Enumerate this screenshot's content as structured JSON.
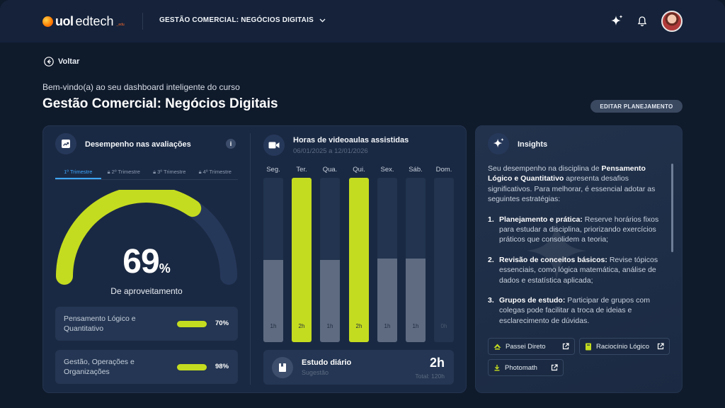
{
  "header": {
    "logo_brand": "uol",
    "logo_product": "edtech",
    "logo_suffix": "_edu",
    "course_selector": "GESTÃO COMERCIAL: NEGÓCIOS DIGITAIS"
  },
  "page": {
    "back_label": "Voltar",
    "welcome": "Bem-vindo(a) ao seu dashboard inteligente do curso",
    "title": "Gestão Comercial: Negócios Digitais",
    "edit_button": "EDITAR PLANEJAMENTO"
  },
  "performance": {
    "title": "Desempenho nas avaliações",
    "info": "i",
    "tabs": [
      "1º Trimestre",
      "2º Trimestre",
      "3º Trimestre",
      "4º Trimestre"
    ],
    "score_value": "69",
    "score_unit": "%",
    "score_fraction": 0.69,
    "score_label": "De aproveitamento",
    "subjects": [
      {
        "name": "Pensamento Lógico e Quantitativo",
        "value": "70%"
      },
      {
        "name": "Gestão, Operações e Organizações",
        "value": "98%"
      }
    ]
  },
  "videos": {
    "title": "Horas de videoaulas assistidas",
    "date_range": "06/01/2025 a 12/01/2026",
    "days": [
      {
        "day": "Seg.",
        "label": "1h",
        "fill": 0.5,
        "highlight": false
      },
      {
        "day": "Ter.",
        "label": "2h",
        "fill": 1.0,
        "highlight": true
      },
      {
        "day": "Qua.",
        "label": "1h",
        "fill": 0.5,
        "highlight": false
      },
      {
        "day": "Qui.",
        "label": "2h",
        "fill": 1.0,
        "highlight": true
      },
      {
        "day": "Sex.",
        "label": "1h",
        "fill": 0.51,
        "highlight": false
      },
      {
        "day": "Sáb.",
        "label": "1h",
        "fill": 0.51,
        "highlight": false
      },
      {
        "day": "Dom.",
        "label": "0h",
        "fill": 0,
        "highlight": false
      }
    ],
    "study_title": "Estudo diário",
    "study_sub": "Sugestão",
    "study_value": "2h",
    "study_total": "Total: 120h"
  },
  "insights": {
    "title": "Insights",
    "intro_a": "Seu desempenho na disciplina de ",
    "intro_b": "Pensamento Lógico e Quantitativo",
    "intro_c": " apresenta desafios significativos. Para melhorar, é essencial adotar as seguintes estratégias:",
    "items": [
      {
        "num": "1.",
        "head": "Planejamento e prática:",
        "text": " Reserve horários fixos para estudar a disciplina, priorizando exercícios práticos que consolidem a teoria;"
      },
      {
        "num": "2.",
        "head": "Revisão de conceitos básicos:",
        "text": " Revise tópicos essenciais, como lógica matemática, análise de dados e estatística aplicada;"
      },
      {
        "num": "3.",
        "head": "Grupos de estudo:",
        "text": " Participar de grupos com colegas pode facilitar a troca de ideias e esclarecimento de dúvidas."
      }
    ],
    "links": [
      "Passei Direto",
      "Raciocínio Lógico",
      "Photomath"
    ]
  },
  "colors": {
    "accent": "#c4dc1f",
    "track": "#26385a",
    "bg": "#0f1a2b"
  }
}
